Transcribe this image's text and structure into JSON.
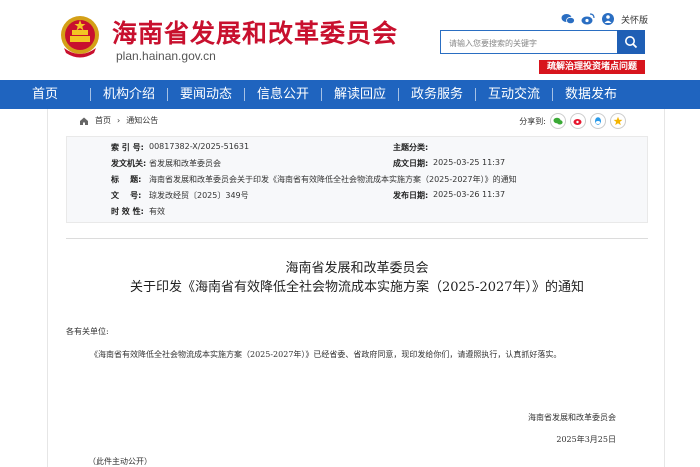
{
  "header": {
    "site_title": "海南省发展和改革委员会",
    "site_domain": "plan.hainan.gov.cn",
    "care_mode_label": "关怀版",
    "search_placeholder": "请输入您要搜索的关键字",
    "promo_badge": "疏解治理投资堵点问题"
  },
  "nav": {
    "items": [
      {
        "label": "首页"
      },
      {
        "label": "机构介绍"
      },
      {
        "label": "要闻动态"
      },
      {
        "label": "信息公开"
      },
      {
        "label": "解读回应"
      },
      {
        "label": "政务服务"
      },
      {
        "label": "互动交流"
      },
      {
        "label": "数据发布"
      }
    ]
  },
  "breadcrumb": {
    "home": "首页",
    "current": "通知公告"
  },
  "share": {
    "label": "分享到:"
  },
  "meta": {
    "index_key": "索 引 号:",
    "index_val": "00817382-X/2025-51631",
    "category_key": "主题分类:",
    "category_val": "",
    "issuer_key": "发文机关:",
    "issuer_val": "省发展和改革委员会",
    "date_key": "成文日期:",
    "date_val": "2025-03-25 11:37",
    "title_key": "标    题:",
    "title_val": "海南省发展和改革委员会关于印发《海南省有效降低全社会物流成本实施方案（2025-2027年）》的通知",
    "docno_key": "文    号:",
    "docno_val": "琼发改经贸〔2025〕349号",
    "pubdate_key": "发布日期:",
    "pubdate_val": "2025-03-26 11:37",
    "validity_key": "时 效 性:",
    "validity_val": "有效"
  },
  "doc": {
    "title_line1": "海南省发展和改革委员会",
    "title_line2": "关于印发《海南省有效降低全社会物流成本实施方案（2025-2027年）》的通知",
    "salutation": "各有关单位:",
    "body": "《海南省有效降低全社会物流成本实施方案（2025-2027年）》已经省委、省政府同意，现印发给你们，请遵照执行，认真抓好落实。",
    "signer": "海南省发展和改革委员会",
    "sign_date": "2025年3月25日",
    "public_note": "（此件主动公开）"
  },
  "colors": {
    "brand_red": "#c8102e",
    "nav_blue": "#1f64bf",
    "badge_red": "#d7141d"
  }
}
